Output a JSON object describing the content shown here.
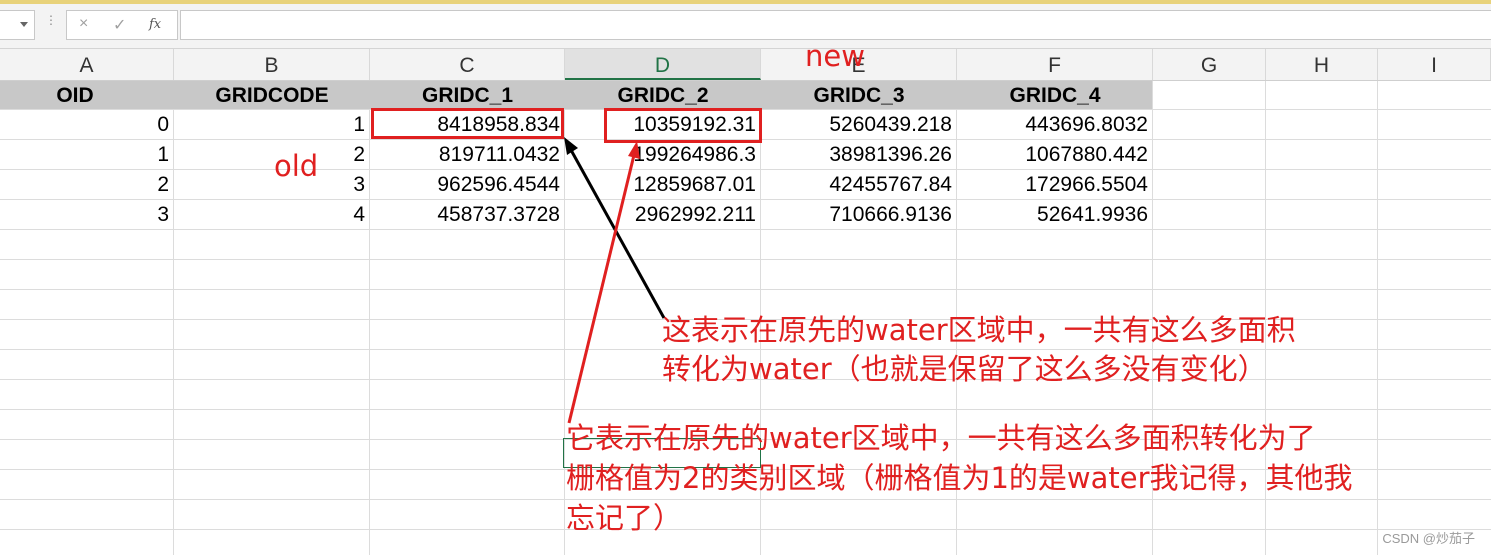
{
  "formula_bar": {
    "cancel_glyph": "×",
    "enter_glyph": "✓",
    "fx_label": "fx",
    "value": ""
  },
  "columns": [
    "A",
    "B",
    "C",
    "D",
    "E",
    "F",
    "G",
    "H",
    "I"
  ],
  "selected_column": "D",
  "headers": [
    "OID",
    "GRIDCODE",
    "GRIDC_1",
    "GRIDC_2",
    "GRIDC_3",
    "GRIDC_4"
  ],
  "rows": [
    [
      "0",
      "1",
      "8418958.834",
      "10359192.31",
      "5260439.218",
      "443696.8032"
    ],
    [
      "1",
      "2",
      "819711.0432",
      "199264986.3",
      "38981396.26",
      "1067880.442"
    ],
    [
      "2",
      "3",
      "962596.4544",
      "12859687.01",
      "42455767.84",
      "172966.5504"
    ],
    [
      "3",
      "4",
      "458737.3728",
      "2962992.211",
      "710666.9136",
      "52641.9936"
    ]
  ],
  "annotations": {
    "new_label": "new",
    "old_label": "old",
    "note1_line1": "这表示在原先的water区域中，一共有这么多面积",
    "note1_line2": "转化为water（也就是保留了这么多没有变化）",
    "note2_line1": "它表示在原先的water区域中，一共有这么多面积转化为了",
    "note2_line2": "栅格值为2的类别区域（栅格值为1的是water我记得，其他我",
    "note2_line3": "忘记了）",
    "color": "#e02020"
  },
  "watermark": "CSDN @炒茄子"
}
